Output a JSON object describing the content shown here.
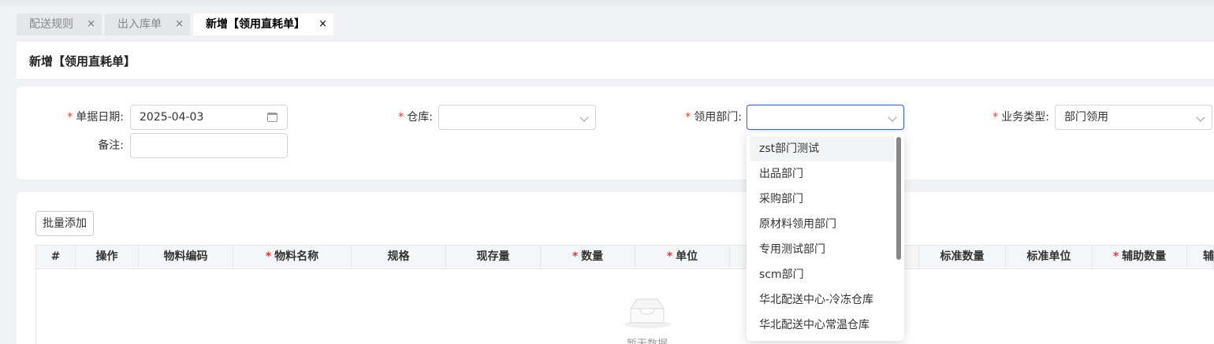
{
  "tabs": [
    {
      "label": "配送规则",
      "close": "×"
    },
    {
      "label": "出入库单",
      "close": "×"
    },
    {
      "label": "新增【领用直耗单】",
      "close": "×"
    }
  ],
  "page_title": "新增【领用直耗单】",
  "form": {
    "required_mark": "*",
    "date_label": "单据日期:",
    "date_value": "2025-04-03",
    "warehouse_label": "仓库:",
    "warehouse_value": "",
    "dept_label": "领用部门:",
    "dept_value": "",
    "biz_type_label": "业务类型:",
    "biz_type_value": "部门领用",
    "remark_label": "备注:",
    "remark_value": ""
  },
  "toolbar": {
    "batch_add_label": "批量添加"
  },
  "table": {
    "columns": [
      {
        "label": "#",
        "required": false
      },
      {
        "label": "操作",
        "required": false
      },
      {
        "label": "物料编码",
        "required": false
      },
      {
        "label": "物料名称",
        "required": true
      },
      {
        "label": "规格",
        "required": false
      },
      {
        "label": "现存量",
        "required": false
      },
      {
        "label": "数量",
        "required": true
      },
      {
        "label": "单位",
        "required": true
      },
      {
        "label": "",
        "required": false
      },
      {
        "label": "标准数量",
        "required": false
      },
      {
        "label": "标准单位",
        "required": false
      },
      {
        "label": "辅助数量",
        "required": true
      },
      {
        "label": "辅",
        "required": false
      }
    ],
    "empty_text": "暂无数据"
  },
  "dept_dropdown": {
    "options": [
      "zst部门测试",
      "出品部门",
      "采购部门",
      "原材料领用部门",
      "专用测试部门",
      "scm部门",
      "华北配送中心-冷冻仓库",
      "华北配送中心常温仓库"
    ],
    "hovered_index": 0
  },
  "colors": {
    "accent": "#3b6be0",
    "required": "#e53935"
  }
}
